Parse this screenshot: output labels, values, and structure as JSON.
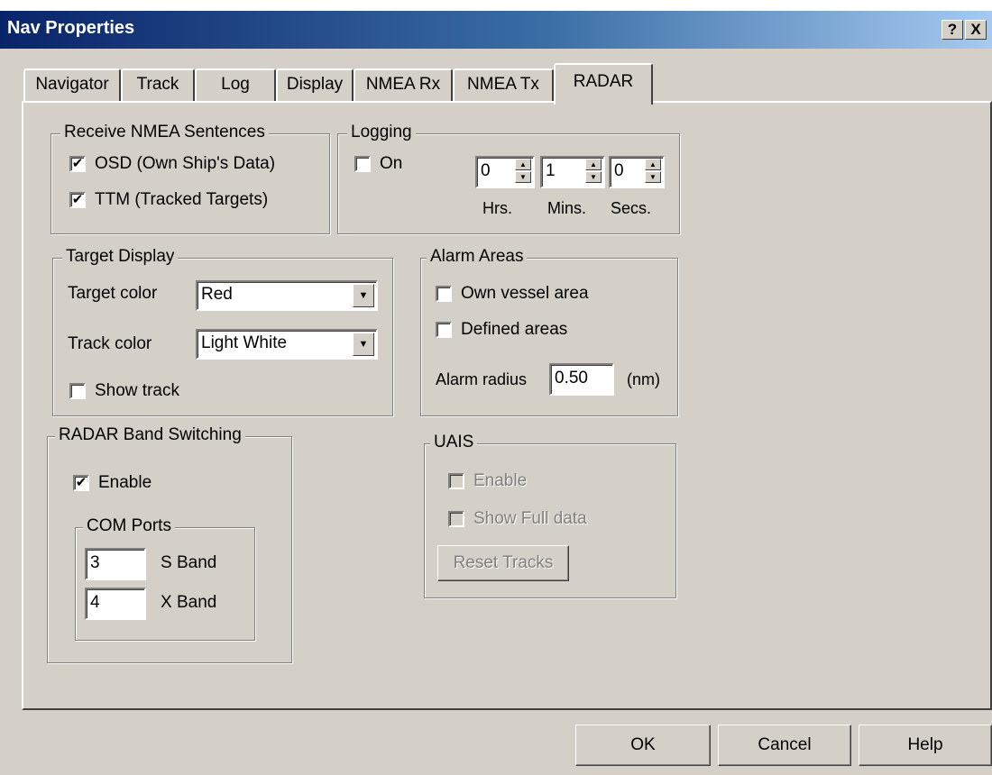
{
  "window": {
    "title": "Nav Properties",
    "help_glyph": "?",
    "close_glyph": "X"
  },
  "tabs": [
    {
      "label": "Navigator"
    },
    {
      "label": "Track"
    },
    {
      "label": "Log"
    },
    {
      "label": "Display"
    },
    {
      "label": "NMEA Rx"
    },
    {
      "label": "NMEA Tx"
    },
    {
      "label": "RADAR",
      "active": true
    }
  ],
  "receive": {
    "title": "Receive NMEA Sentences",
    "osd": {
      "label": "OSD (Own Ship's Data)",
      "checked": true
    },
    "ttm": {
      "label": "TTM (Tracked Targets)",
      "checked": true
    }
  },
  "logging": {
    "title": "Logging",
    "on": {
      "label": "On",
      "checked": false
    },
    "hrs": "0",
    "mins": "1",
    "secs": "0",
    "hrs_label": "Hrs.",
    "mins_label": "Mins.",
    "secs_label": "Secs."
  },
  "target_display": {
    "title": "Target Display",
    "target_color_label": "Target color",
    "target_color": "Red",
    "track_color_label": "Track color",
    "track_color": "Light White",
    "show_track": {
      "label": "Show track",
      "checked": false
    }
  },
  "alarm": {
    "title": "Alarm Areas",
    "own_vessel": {
      "label": "Own vessel area",
      "checked": false
    },
    "defined": {
      "label": "Defined areas",
      "checked": false
    },
    "radius_label": "Alarm radius",
    "radius": "0.50",
    "unit": "(nm)"
  },
  "band": {
    "title": "RADAR Band Switching",
    "enable": {
      "label": "Enable",
      "checked": true
    },
    "com_title": "COM Ports",
    "s_port": "3",
    "s_label": "S Band",
    "x_port": "4",
    "x_label": "X Band"
  },
  "uais": {
    "title": "UAIS",
    "enable": {
      "label": "Enable"
    },
    "full": {
      "label": "Show Full data"
    },
    "reset": "Reset Tracks"
  },
  "buttons": {
    "ok": "OK",
    "cancel": "Cancel",
    "help": "Help"
  },
  "glyphs": {
    "check": "✔",
    "up": "▲",
    "down": "▼"
  }
}
